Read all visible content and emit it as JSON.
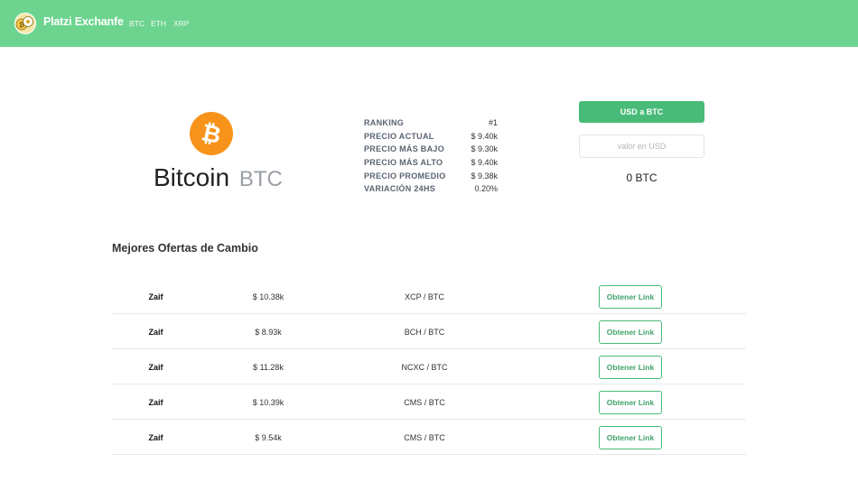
{
  "navbar": {
    "brand": "Platzi Exchanfe",
    "links": [
      "BTC",
      "ETH",
      "XRP"
    ],
    "background": "#6dd48f"
  },
  "coin": {
    "name": "Bitcoin",
    "symbol": "BTC",
    "icon": "bitcoin-logo-icon",
    "icon_color": "#f7931a"
  },
  "stats": [
    {
      "label": "RANKING",
      "value": "#1"
    },
    {
      "label": "PRECIO ACTUAL",
      "value": "$ 9.40k"
    },
    {
      "label": "PRECIO MÁS BAJO",
      "value": "$ 9.30k"
    },
    {
      "label": "PRECIO MÁS ALTO",
      "value": "$ 9.40k"
    },
    {
      "label": "PRECIO PROMEDIO",
      "value": "$ 9.38k"
    },
    {
      "label": "VARIACIÓN 24HS",
      "value": "0.20%"
    }
  ],
  "converter": {
    "button_label": "USD a BTC",
    "input_placeholder": "valor en USD",
    "input_value": "",
    "result": "0 BTC",
    "accent": "#48bb78"
  },
  "offers_section": {
    "title": "Mejores Ofertas de Cambio",
    "rows": [
      {
        "exchange": "Zaif",
        "price": "$ 10.38k",
        "pair": "XCP / BTC",
        "link_label": "Obtener Link"
      },
      {
        "exchange": "Zaif",
        "price": "$ 8.93k",
        "pair": "BCH / BTC",
        "link_label": "Obtener Link"
      },
      {
        "exchange": "Zaif",
        "price": "$ 11.28k",
        "pair": "NCXC / BTC",
        "link_label": "Obtener Link"
      },
      {
        "exchange": "Zaif",
        "price": "$ 10.39k",
        "pair": "CMS / BTC",
        "link_label": "Obtener Link"
      },
      {
        "exchange": "Zaif",
        "price": "$ 9.54k",
        "pair": "CMS / BTC",
        "link_label": "Obtener Link"
      }
    ]
  }
}
